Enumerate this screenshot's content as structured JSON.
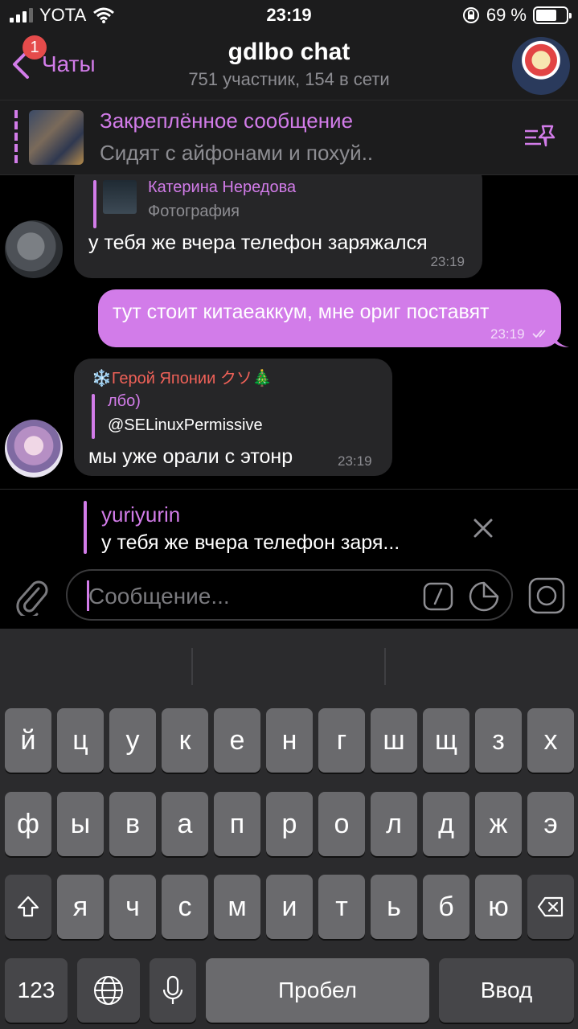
{
  "status_bar": {
    "carrier": "YOTA",
    "time": "23:19",
    "battery_percent": "69 %",
    "battery_level": 0.69
  },
  "header": {
    "back_label": "Чаты",
    "unread_badge": "1",
    "title": "gdlbo chat",
    "subtitle": "751 участник, 154 в сети"
  },
  "pinned": {
    "title": "Закреплённое сообщение",
    "text": "Сидят с айфонами и похуй.."
  },
  "messages": [
    {
      "kind": "incoming",
      "quote_name": "Катерина Нередова",
      "quote_text": "Фотография",
      "text": "у тебя же вчера телефон заряжался",
      "time": "23:19"
    },
    {
      "kind": "outgoing",
      "text": "тут стоит китаеаккум, мне ориг поставят",
      "time": "23:19"
    },
    {
      "kind": "incoming",
      "sender": "❄️Герой Японии クソ🎄",
      "quote_name": "лбо)",
      "quote_text": "@SELinuxPermissive",
      "text": "мы уже орали с этонр",
      "time": "23:19"
    }
  ],
  "reply": {
    "name": "yuriyurin",
    "text": "у тебя же вчера телефон заря..."
  },
  "input": {
    "placeholder": "Сообщение..."
  },
  "keyboard": {
    "row1": [
      "й",
      "ц",
      "у",
      "к",
      "е",
      "н",
      "г",
      "ш",
      "щ",
      "з",
      "х"
    ],
    "row2": [
      "ф",
      "ы",
      "в",
      "а",
      "п",
      "р",
      "о",
      "л",
      "д",
      "ж",
      "э"
    ],
    "row3": [
      "я",
      "ч",
      "с",
      "м",
      "и",
      "т",
      "ь",
      "б",
      "ю"
    ],
    "numbers": "123",
    "space": "Пробел",
    "enter": "Ввод"
  },
  "colors": {
    "accent": "#d27ce9",
    "outgoing_bubble": "#d27ce9",
    "incoming_bubble": "#262628",
    "sender_name": "#ef6158",
    "badge": "#e54b4b"
  },
  "icons": [
    "signal-icon",
    "wifi-icon",
    "lock-rotation-icon",
    "battery-icon",
    "chevron-left-icon",
    "pin-list-icon",
    "check-double-icon",
    "close-icon",
    "paperclip-icon",
    "command-icon",
    "sticker-icon",
    "camera-icon",
    "shift-icon",
    "backspace-icon",
    "globe-icon",
    "microphone-icon"
  ]
}
